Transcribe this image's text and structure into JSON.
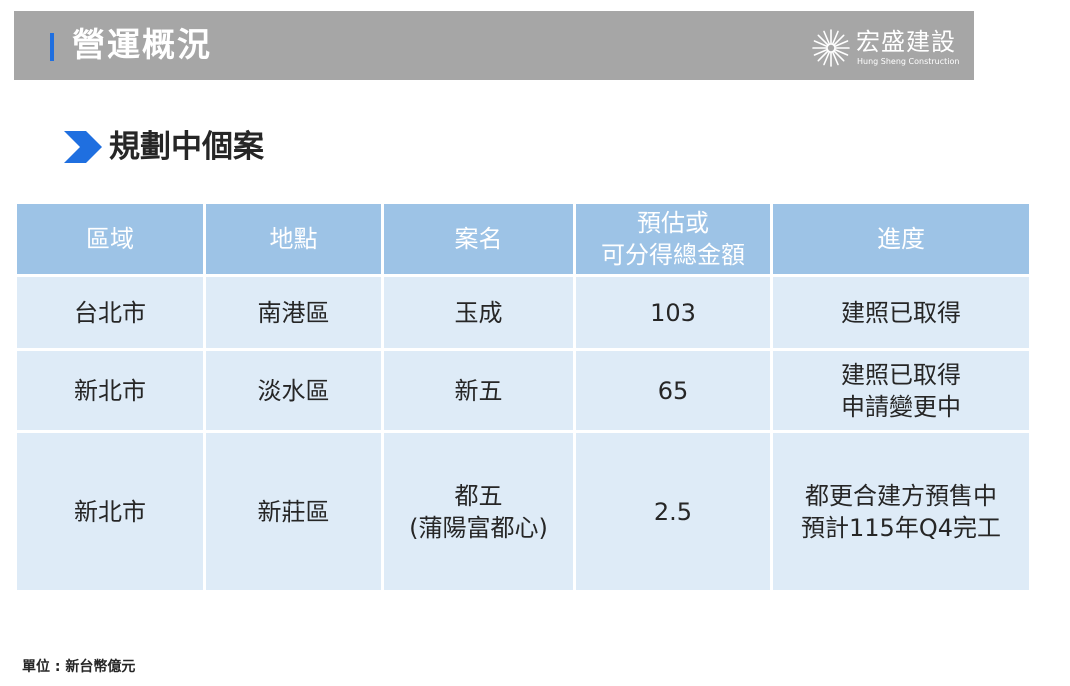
{
  "header": {
    "title": "營運概況",
    "logo_name": "宏盛建設",
    "logo_subtitle": "Hung Sheng Construction"
  },
  "section": {
    "title": "規劃中個案"
  },
  "table": {
    "headers": [
      [
        "區域"
      ],
      [
        "地點"
      ],
      [
        "案名"
      ],
      [
        "預估或",
        "可分得總金額"
      ],
      [
        "進度"
      ]
    ],
    "rows": [
      [
        [
          "台北市"
        ],
        [
          "南港區"
        ],
        [
          "玉成"
        ],
        [
          "103"
        ],
        [
          "建照已取得"
        ]
      ],
      [
        [
          "新北市"
        ],
        [
          "淡水區"
        ],
        [
          "新五"
        ],
        [
          "65"
        ],
        [
          "建照已取得",
          "申請變更中"
        ]
      ],
      [
        [
          "新北市"
        ],
        [
          "新莊區"
        ],
        [
          "都五",
          "(蒲陽富都心)"
        ],
        [
          "2.5"
        ],
        [
          "都更合建方預售中",
          "預計115年Q4完工"
        ]
      ]
    ]
  },
  "footer": {
    "unit_note": "單位 : 新台幣億元"
  },
  "colors": {
    "header_bar": "#a6a6a6",
    "accent_blue": "#1f6fe0",
    "table_header": "#9dc3e6",
    "table_cell": "#deebf7"
  },
  "icons": {
    "logo": "sunburst-logo-icon",
    "section_marker": "chevron-right-icon"
  }
}
